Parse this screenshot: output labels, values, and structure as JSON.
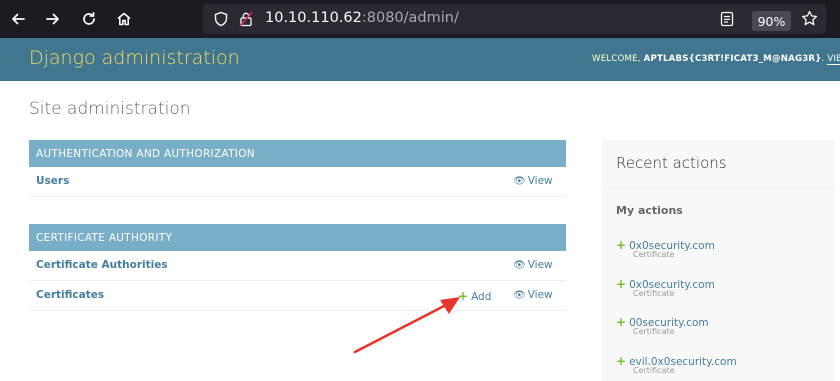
{
  "browser": {
    "url_host": "10.10.110.62",
    "url_rest": ":8080/admin/",
    "zoom": "90%"
  },
  "header": {
    "branding": "Django administration",
    "welcome": "WELCOME, ",
    "username": "APTLABS{C3RT!FICAT3_M@NAG3R}",
    "view_site": "VIE"
  },
  "main": {
    "title": "Site administration",
    "modules": [
      {
        "caption": "AUTHENTICATION AND AUTHORIZATION",
        "rows": [
          {
            "label": "Users",
            "view": "View"
          }
        ]
      },
      {
        "caption": "CERTIFICATE AUTHORITY",
        "rows": [
          {
            "label": "Certificate Authorities",
            "view": "View"
          },
          {
            "label": "Certificates",
            "add": "Add",
            "view": "View"
          }
        ]
      }
    ]
  },
  "recent": {
    "title": "Recent actions",
    "subtitle": "My actions",
    "items": [
      {
        "name": "0x0security.com",
        "type": "Certificate"
      },
      {
        "name": "0x0security.com",
        "type": "Certificate"
      },
      {
        "name": "00security.com",
        "type": "Certificate"
      },
      {
        "name": "evil.0x0security.com",
        "type": "Certificate"
      }
    ]
  },
  "colors": {
    "header_bg": "#417690",
    "branding": "#f5dd5d",
    "caption_bg": "#79aec8",
    "link": "#447e9b",
    "add_green": "#70bf2b",
    "annotation_arrow": "#e8352a"
  },
  "icons": [
    "back-arrow-icon",
    "forward-arrow-icon",
    "reload-icon",
    "home-icon",
    "shield-icon",
    "lock-icon",
    "reader-icon",
    "star-icon",
    "eye-icon",
    "plus-icon"
  ]
}
